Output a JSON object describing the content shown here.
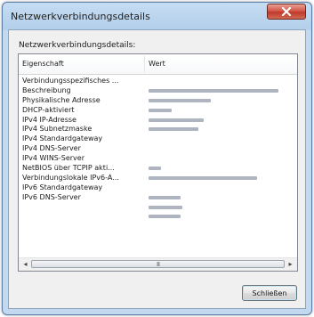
{
  "window": {
    "title": "Netzwerkverbindungsdetails",
    "close_icon": "close-icon"
  },
  "section_label": "Netzwerkverbindungsdetails:",
  "table": {
    "columns": [
      "Eigenschaft",
      "Wert"
    ],
    "rows": [
      {
        "property": "Verbindungsspezifisches ...",
        "value_redacted": false
      },
      {
        "property": "Beschreibung",
        "value_redacted": true
      },
      {
        "property": "Physikalische Adresse",
        "value_redacted": true
      },
      {
        "property": "DHCP-aktiviert",
        "value_redacted": true
      },
      {
        "property": "IPv4 IP-Adresse",
        "value_redacted": true
      },
      {
        "property": "IPv4 Subnetzmaske",
        "value_redacted": true
      },
      {
        "property": "IPv4 Standardgateway",
        "value_redacted": false
      },
      {
        "property": "IPv4 DNS-Server",
        "value_redacted": false
      },
      {
        "property": "IPv4 WINS-Server",
        "value_redacted": false
      },
      {
        "property": "NetBIOS über TCPIP akti...",
        "value_redacted": true
      },
      {
        "property": "Verbindungslokale IPv6-A...",
        "value_redacted": true
      },
      {
        "property": "IPv6 Standardgateway",
        "value_redacted": false
      },
      {
        "property": "IPv6 DNS-Server",
        "value_redacted": true
      },
      {
        "property": "",
        "value_redacted": true
      },
      {
        "property": "",
        "value_redacted": true
      }
    ]
  },
  "scrollbar": {
    "left_arrow": "◂",
    "right_arrow": "▸",
    "grip": "III"
  },
  "buttons": {
    "close_label": "Schließen"
  }
}
